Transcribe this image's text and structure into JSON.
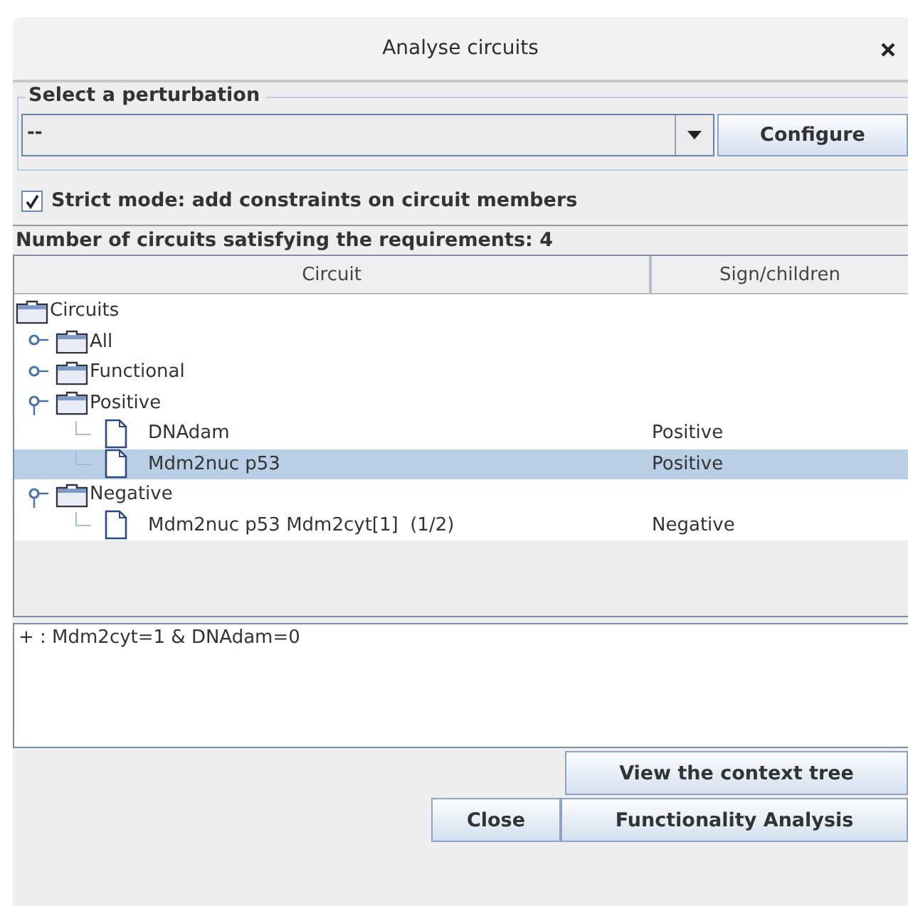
{
  "window": {
    "title": "Analyse circuits"
  },
  "perturbation": {
    "legend": "Select a perturbation",
    "value": "--",
    "button": "Configure"
  },
  "strict_mode": {
    "label": "Strict mode: add constraints on circuit members",
    "checked": true
  },
  "count_label": "Number of circuits satisfying the requirements: 4",
  "table": {
    "columns": [
      "Circuit",
      "Sign/children"
    ],
    "tree": {
      "label": "Circuits",
      "kind": "folder",
      "selected": false,
      "children": [
        {
          "label": "All",
          "kind": "folder",
          "expanded": false,
          "selected": false
        },
        {
          "label": "Functional",
          "kind": "folder",
          "expanded": false,
          "selected": false
        },
        {
          "label": "Positive",
          "kind": "folder",
          "expanded": true,
          "selected": false,
          "children": [
            {
              "label": "DNAdam",
              "kind": "leaf",
              "sign": "Positive",
              "selected": false
            },
            {
              "label": "Mdm2nuc p53",
              "kind": "leaf",
              "sign": "Positive",
              "selected": true
            }
          ]
        },
        {
          "label": "Negative",
          "kind": "folder",
          "expanded": true,
          "selected": false,
          "children": [
            {
              "label": "Mdm2nuc p53 Mdm2cyt[1]  (1/2)",
              "kind": "leaf",
              "sign": "Negative",
              "selected": false
            }
          ]
        }
      ]
    }
  },
  "details": {
    "value": "+ : Mdm2cyt=1 & DNAdam=0"
  },
  "buttons": {
    "context_tree": "View the context tree",
    "close": "Close",
    "functionality": "Functionality Analysis"
  }
}
